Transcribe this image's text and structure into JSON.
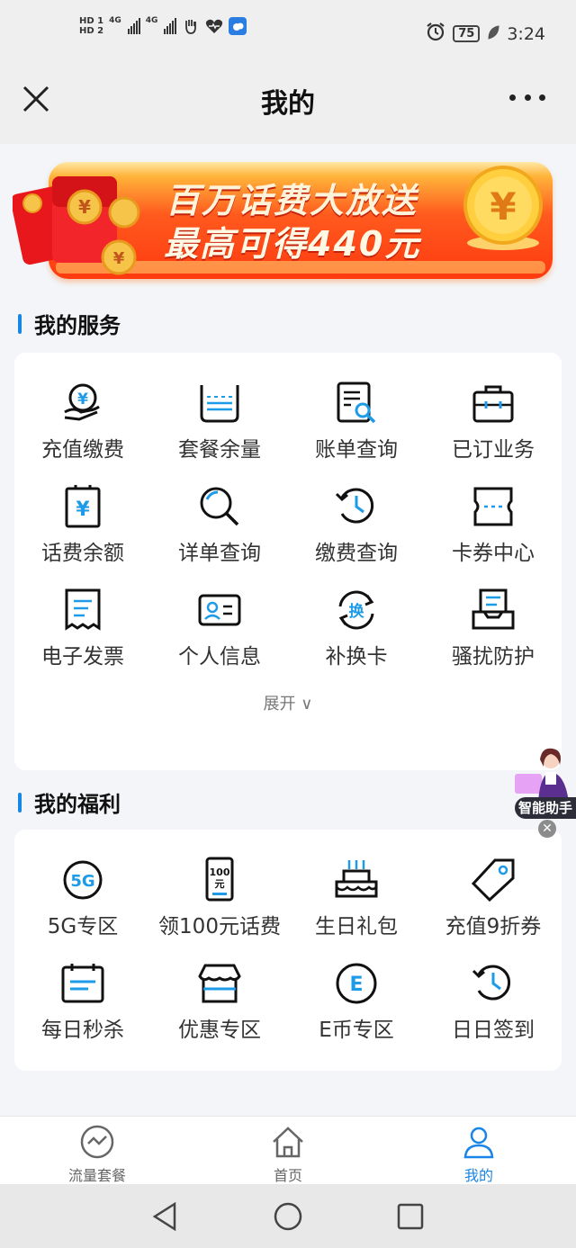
{
  "status_bar": {
    "hd1": "HD 1",
    "hd2": "HD 2",
    "network1": "4G",
    "network2": "4G",
    "battery": "75",
    "time": "3:24"
  },
  "header": {
    "title": "我的"
  },
  "banner": {
    "line1": "百万话费大放送",
    "line2": "最高可得440元"
  },
  "services": {
    "title": "我的服务",
    "items": [
      {
        "label": "充值缴费",
        "icon": "recharge-icon"
      },
      {
        "label": "套餐余量",
        "icon": "package-balance-icon"
      },
      {
        "label": "账单查询",
        "icon": "bill-query-icon"
      },
      {
        "label": "已订业务",
        "icon": "subscribed-icon"
      },
      {
        "label": "话费余额",
        "icon": "balance-icon"
      },
      {
        "label": "详单查询",
        "icon": "detail-query-icon"
      },
      {
        "label": "缴费查询",
        "icon": "payment-query-icon"
      },
      {
        "label": "卡券中心",
        "icon": "coupon-center-icon"
      },
      {
        "label": "电子发票",
        "icon": "invoice-icon"
      },
      {
        "label": "个人信息",
        "icon": "personal-info-icon"
      },
      {
        "label": "补换卡",
        "icon": "replace-card-icon"
      },
      {
        "label": "骚扰防护",
        "icon": "harassment-icon"
      }
    ],
    "expand_label": "展开 ∨"
  },
  "benefits": {
    "title": "我的福利",
    "items": [
      {
        "label": "5G专区",
        "icon": "5g-icon"
      },
      {
        "label": "领100元话费",
        "icon": "phone-100-icon"
      },
      {
        "label": "生日礼包",
        "icon": "birthday-cake-icon"
      },
      {
        "label": "充值9折券",
        "icon": "discount-tag-icon"
      },
      {
        "label": "每日秒杀",
        "icon": "calendar-icon"
      },
      {
        "label": "优惠专区",
        "icon": "shop-icon"
      },
      {
        "label": "E币专区",
        "icon": "e-coin-icon"
      },
      {
        "label": "日日签到",
        "icon": "checkin-icon"
      }
    ]
  },
  "assistant": {
    "label": "智能助手"
  },
  "bottom_nav": [
    {
      "label": "流量套餐",
      "icon": "data-plan-icon"
    },
    {
      "label": "首页",
      "icon": "home-icon"
    },
    {
      "label": "我的",
      "icon": "profile-icon"
    }
  ],
  "colors": {
    "accent": "#1a85e6",
    "section_bar": "#1687e8",
    "icon_blue": "#1e9be8"
  }
}
